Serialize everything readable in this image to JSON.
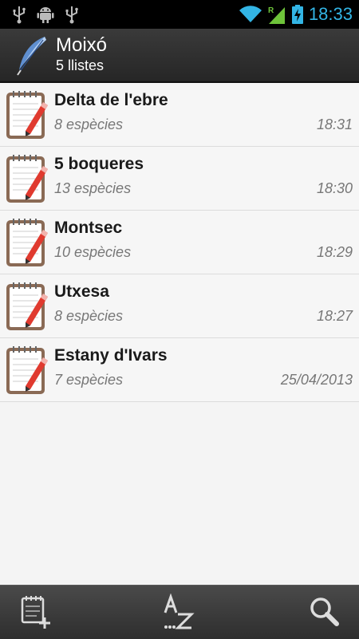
{
  "status_bar": {
    "time": "18:33",
    "icons": [
      "usb-icon",
      "android-debug-icon",
      "usb-icon",
      "wifi-icon",
      "signal-roaming-icon",
      "battery-charging-icon"
    ],
    "accent_color": "#33b5e5"
  },
  "action_bar": {
    "title": "Moixó",
    "subtitle": "5 llistes",
    "logo_icon": "feather-quill-icon"
  },
  "lists": [
    {
      "title": "Delta de l'ebre",
      "count": "8 espècies",
      "time": "18:31"
    },
    {
      "title": "5 boqueres",
      "count": "13 espècies",
      "time": "18:30"
    },
    {
      "title": "Montsec",
      "count": "10 espècies",
      "time": "18:29"
    },
    {
      "title": "Utxesa",
      "count": "8 espècies",
      "time": "18:27"
    },
    {
      "title": "Estany d'Ivars",
      "count": "7 espècies",
      "time": "25/04/2013"
    }
  ],
  "bottom_bar": {
    "buttons": [
      "new-list-icon",
      "sort-az-icon",
      "search-icon"
    ],
    "sort_label": "AZ"
  }
}
